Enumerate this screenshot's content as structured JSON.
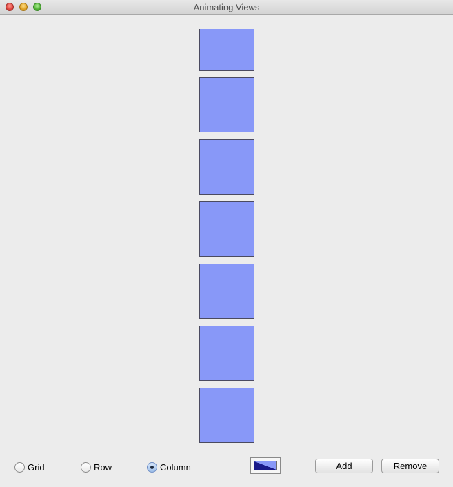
{
  "window": {
    "title": "Animating Views"
  },
  "views": {
    "count": 7,
    "color": "#8898f8",
    "border_color": "#4a4a60"
  },
  "layout_options": {
    "grid_label": "Grid",
    "row_label": "Row",
    "column_label": "Column",
    "selected": "Column"
  },
  "color_well": {
    "dark_color": "#1a1a8a",
    "light_color": "#8898f8"
  },
  "buttons": {
    "add_label": "Add",
    "remove_label": "Remove"
  },
  "icons": {
    "close": "close-icon",
    "minimize": "minimize-icon",
    "zoom": "zoom-icon"
  }
}
